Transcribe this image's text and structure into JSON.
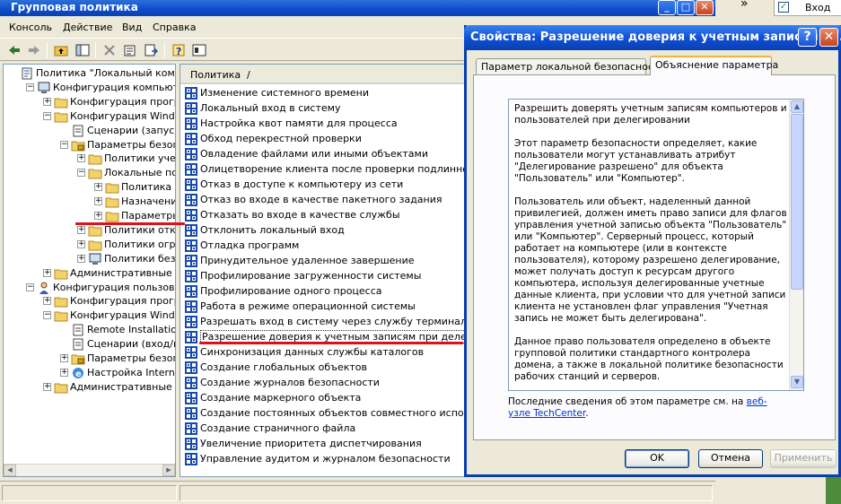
{
  "main": {
    "title": "Групповая политика",
    "window_buttons": {
      "min": "_",
      "max": "□",
      "close": "✕"
    }
  },
  "menu": [
    "Консоль",
    "Действие",
    "Вид",
    "Справка"
  ],
  "tree": {
    "items": [
      {
        "label": "Политика \"Локальный компьюте",
        "exp": "",
        "icon": "policy"
      },
      {
        "label": "Конфигурация компьютера",
        "exp": "−",
        "icon": "computer"
      },
      {
        "label": "Конфигурация программ",
        "exp": "+",
        "icon": "folder"
      },
      {
        "label": "Конфигурация Windows",
        "exp": "−",
        "icon": "folder"
      },
      {
        "label": "Сценарии (запуск/заве",
        "exp": "",
        "icon": "script"
      },
      {
        "label": "Параметры безопаснос",
        "exp": "−",
        "icon": "security"
      },
      {
        "label": "Политики учетны",
        "exp": "+",
        "icon": "folder"
      },
      {
        "label": "Локальные полит",
        "exp": "−",
        "icon": "folder"
      },
      {
        "label": "Политика ауд",
        "exp": "+",
        "icon": "folder"
      },
      {
        "label": "Назначение пр",
        "exp": "+",
        "icon": "folder"
      },
      {
        "label": "Параметры бе",
        "exp": "+",
        "icon": "folder"
      },
      {
        "label": "Политики открыт",
        "exp": "+",
        "icon": "folder"
      },
      {
        "label": "Политики огранич",
        "exp": "+",
        "icon": "folder"
      },
      {
        "label": "Политики безопас",
        "exp": "+",
        "icon": "computer"
      },
      {
        "label": "Административные шабл",
        "exp": "+",
        "icon": "folder"
      },
      {
        "label": "Конфигурация пользователя",
        "exp": "−",
        "icon": "user"
      },
      {
        "label": "Конфигурация программ",
        "exp": "+",
        "icon": "folder"
      },
      {
        "label": "Конфигурация Windows",
        "exp": "−",
        "icon": "folder"
      },
      {
        "label": "Remote Installation Ser",
        "exp": "",
        "icon": "script"
      },
      {
        "label": "Сценарии (вход/выхо",
        "exp": "",
        "icon": "script"
      },
      {
        "label": "Параметры безопаснос",
        "exp": "+",
        "icon": "security"
      },
      {
        "label": "Настройка Internet Ex",
        "exp": "+",
        "icon": "ie"
      },
      {
        "label": "Административные шабл",
        "exp": "+",
        "icon": "folder"
      }
    ]
  },
  "list": {
    "header": "Политика",
    "header_sort": "/",
    "items": [
      "Изменение системного времени",
      "Локальный вход в систему",
      "Настройка квот памяти для процесса",
      "Обход перекрестной проверки",
      "Овладение файлами или иными объектами",
      "Олицетворение клиента после проверки подлинности",
      "Отказ в доступе к компьютеру из сети",
      "Отказ во входе в качестве пакетного задания",
      "Отказать во входе в качестве службы",
      "Отклонить локальный вход",
      "Отладка программ",
      "Принудительное удаленное завершение",
      "Профилирование загруженности системы",
      "Профилирование одного процесса",
      "Работа в режиме операционной системы",
      "Разрешать вход в систему через службу терминалов",
      "Разрешение доверия к учетным записям при делегирова.",
      "Синхронизация данных службы каталогов",
      "Создание глобальных объектов",
      "Создание журналов безопасности",
      "Создание маркерного объекта",
      "Создание постоянных объектов совместного использова.",
      "Создание страничного файла",
      "Увеличение приоритета диспетчирования",
      "Управление аудитом и журналом безопасности"
    ],
    "selected_index": 16
  },
  "background": {
    "entry_label": "Вход"
  },
  "dialog": {
    "title": "Свойства: Разрешение доверия к учетным записям п...",
    "help": "?",
    "close": "✕",
    "tabs": [
      "Параметр локальной безопасности",
      "Объяснение параметра"
    ],
    "explanation": [
      "Разрешить доверять учетным записям компьютеров и пользователей при делегировании",
      "Этот параметр безопасности определяет, какие пользователи могут устанавливать атрибут \"Делегирование разрешено\" для объекта \"Пользователь\" или \"Компьютер\".",
      "Пользователь или объект, наделенный данной привилегией, должен иметь право записи для флагов управления учетной записью объекта \"Пользователь\" или \"Компьютер\". Серверный процесс, который работает на компьютере (или в контексте пользователя), которому разрешено делегирование, может получать доступ к ресурсам другого компьютера, используя делегированные учетные данные клиента, при условии что для учетной записи клиента не установлен флаг управления \"Учетная запись не может быть делегирована\".",
      "Данное право пользователя определено в объекте групповой политики стандартного контролера домена, а также в локальной политике безопасности рабочих станций и серверов."
    ],
    "more_info_prefix": "Последние сведения об этом параметре см. на ",
    "more_info_link": "веб-узле TechCenter",
    "more_info_suffix": ".",
    "buttons": {
      "ok": "OK",
      "cancel": "Отмена",
      "apply": "Применить"
    }
  }
}
